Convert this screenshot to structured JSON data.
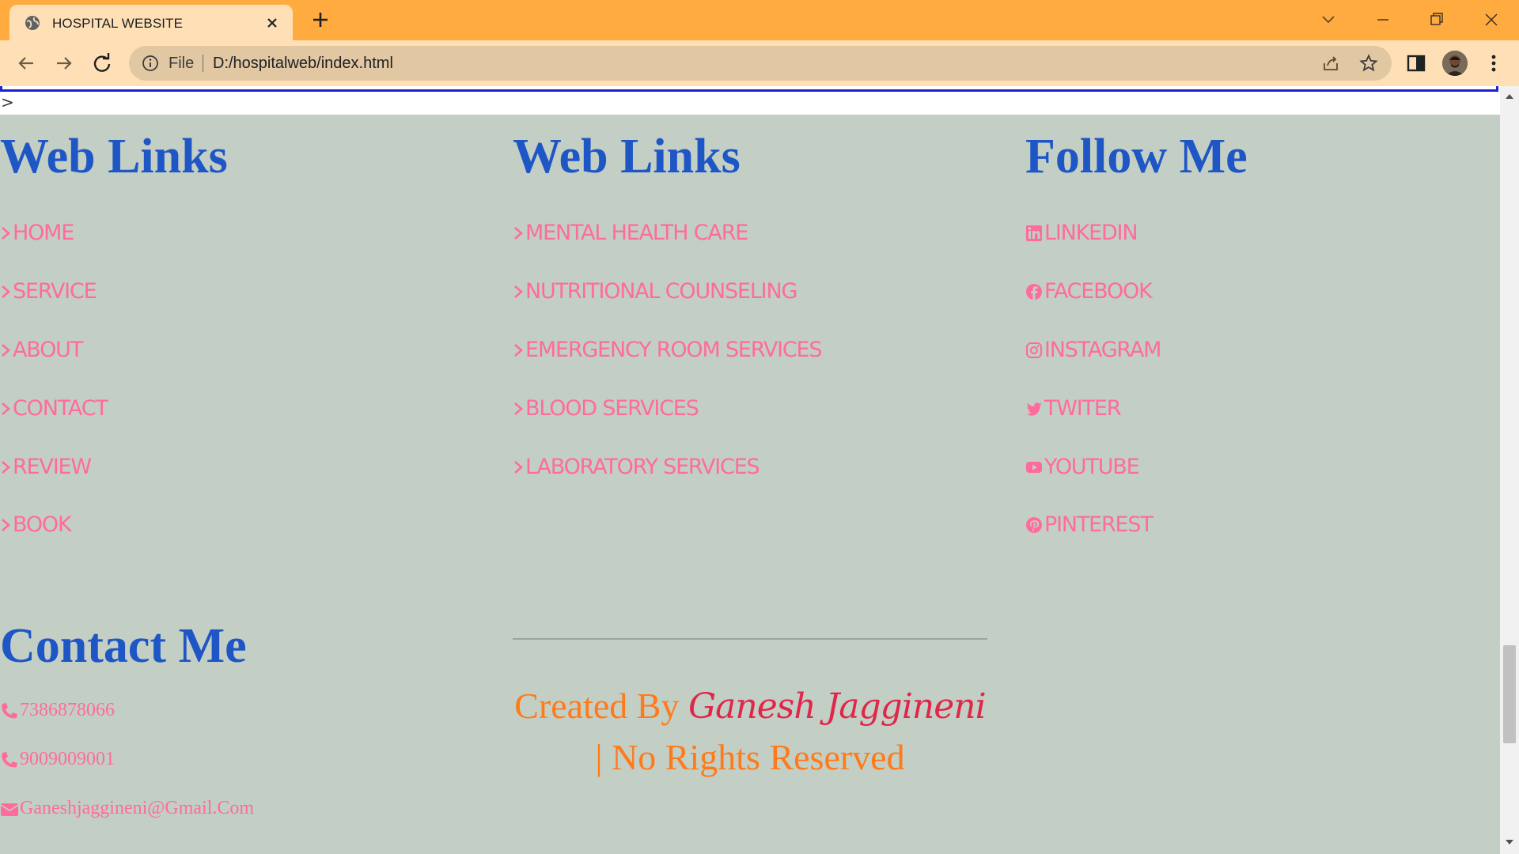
{
  "browser": {
    "tab_title": "HOSPITAL WEBSITE",
    "omnibox_scheme": "File",
    "url": "D:/hospitalweb/index.html"
  },
  "page": {
    "stray_text": ">",
    "columns": [
      {
        "heading": "Web Links",
        "links": [
          "HOME",
          "SERVICE",
          "ABOUT",
          "CONTACT",
          "REVIEW",
          "BOOK"
        ]
      },
      {
        "heading": "Web Links",
        "links": [
          "MENTAL HEALTH CARE",
          "NUTRITIONAL COUNSELING",
          "EMERGENCY ROOM SERVICES",
          "BLOOD SERVICES",
          "LABORATORY SERVICES"
        ]
      },
      {
        "heading": "Follow Me",
        "links": [
          {
            "label": "LINKEDIN",
            "icon": "linkedin-icon"
          },
          {
            "label": "FACEBOOK",
            "icon": "facebook-icon"
          },
          {
            "label": "INSTAGRAM",
            "icon": "instagram-icon"
          },
          {
            "label": "TWITER",
            "icon": "twitter-icon"
          },
          {
            "label": "YOUTUBE",
            "icon": "youtube-icon"
          },
          {
            "label": "PINTEREST",
            "icon": "pinterest-icon"
          }
        ]
      }
    ],
    "contact": {
      "heading": "Contact Me",
      "phone1": "7386878066",
      "phone2": "9009009001",
      "email": "Ganeshjaggineni@Gmail.Com"
    },
    "credit": {
      "prefix": "Created By",
      "name": "Ganesh Jaggineni",
      "suffix": "| No Rights Reserved"
    }
  },
  "colors": {
    "tabbar": "#ffab40",
    "page_bg": "#c3cfc4",
    "heading": "#1f56c6",
    "link": "#ff6b9d",
    "credit": "#ff7a1a",
    "credit_name": "#e0264a"
  }
}
